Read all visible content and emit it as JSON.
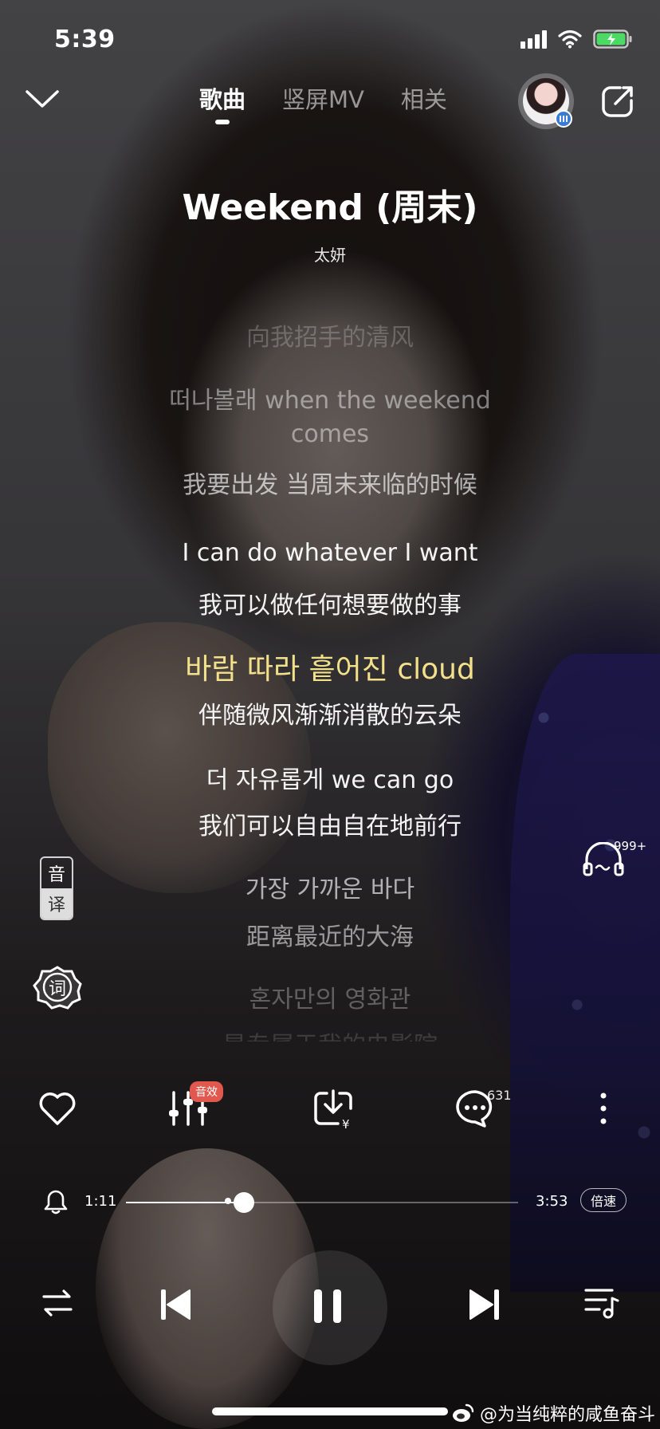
{
  "status_bar": {
    "time": "5:39"
  },
  "nav": {
    "tabs": [
      {
        "label": "歌曲",
        "active": true
      },
      {
        "label": "竖屏MV",
        "active": false
      },
      {
        "label": "相关",
        "active": false
      }
    ]
  },
  "song": {
    "title": "Weekend (周末)",
    "artist": "太妍"
  },
  "lyrics": [
    {
      "text": "向我招手的清风",
      "color": "rgba(255,255,255,0.22)"
    },
    {
      "text": "떠나볼래 when the weekend",
      "color": "rgba(255,255,255,0.45)"
    },
    {
      "text": "comes",
      "color": "rgba(255,255,255,0.45)"
    },
    {
      "text": "我要出发 当周末来临的时候",
      "color": "rgba(255,255,255,0.65)"
    },
    {
      "text": "I can do whatever I want",
      "color": "rgba(255,255,255,0.95)"
    },
    {
      "text": "我可以做任何想要做的事",
      "color": "rgba(255,255,255,0.95)"
    },
    {
      "text": "바람 따라 흩어진 cloud",
      "color": "#f3e08a"
    },
    {
      "text": "伴随微风渐渐消散的云朵",
      "color": "rgba(255,255,255,0.95)"
    },
    {
      "text": "더 자유롭게 we can go",
      "color": "rgba(255,255,255,0.95)"
    },
    {
      "text": "我们可以自由自在地前行",
      "color": "rgba(255,255,255,0.95)"
    },
    {
      "text": "가장 가까운 바다",
      "color": "rgba(255,255,255,0.65)"
    },
    {
      "text": "距离最近的大海",
      "color": "rgba(255,255,255,0.55)"
    },
    {
      "text": "혼자만의 영화관",
      "color": "rgba(255,255,255,0.30)"
    },
    {
      "text": "是专属于我的电影院",
      "color": "rgba(255,255,255,0.15)"
    }
  ],
  "side": {
    "yin": "音",
    "yi": "译",
    "ci": "词",
    "listen_count": "999+"
  },
  "actions": {
    "fx_badge": "音效",
    "comment_count": "631"
  },
  "progress": {
    "current": "1:11",
    "total": "3:53",
    "played_fraction": 0.3,
    "buffered_fraction": 0.26,
    "speed_label": "倍速"
  },
  "watermark": "@为当纯粹的咸鱼奋斗",
  "colors": {
    "highlight_lyric": "#f3e08a",
    "fx_badge": "#e0584e",
    "avatar_badge": "#3a7bd5"
  }
}
